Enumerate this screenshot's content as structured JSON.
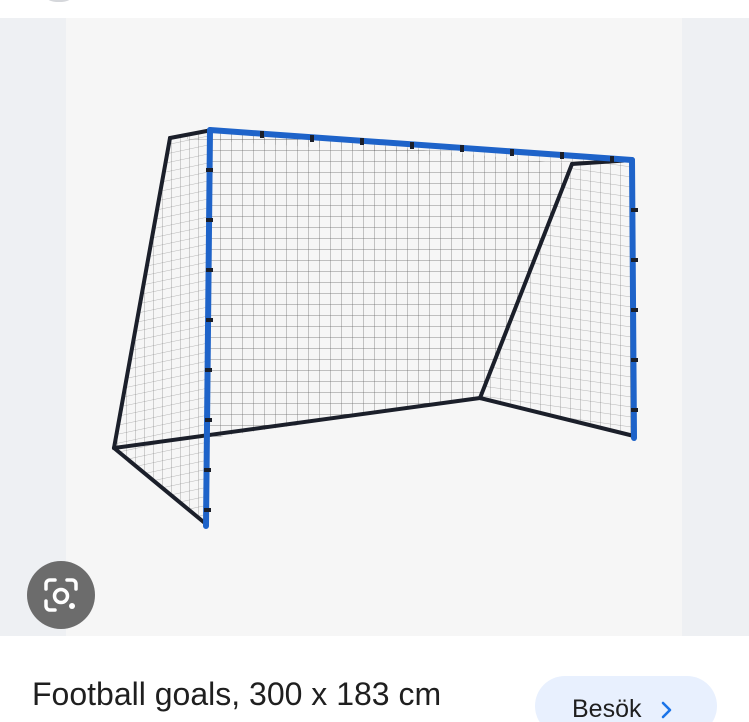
{
  "result": {
    "title": "Football goals, 300 x 183 cm",
    "visit_label": "Besök"
  },
  "icons": {
    "lens": "google-lens-icon",
    "visit": "chevron-right-icon"
  },
  "colors": {
    "post_blue": "#1e63c9",
    "frame_black": "#1b1f2a",
    "lens_bg": "#6c6c6c",
    "visit_bg": "#e8f0fe",
    "visit_chevron": "#1a73e8"
  }
}
